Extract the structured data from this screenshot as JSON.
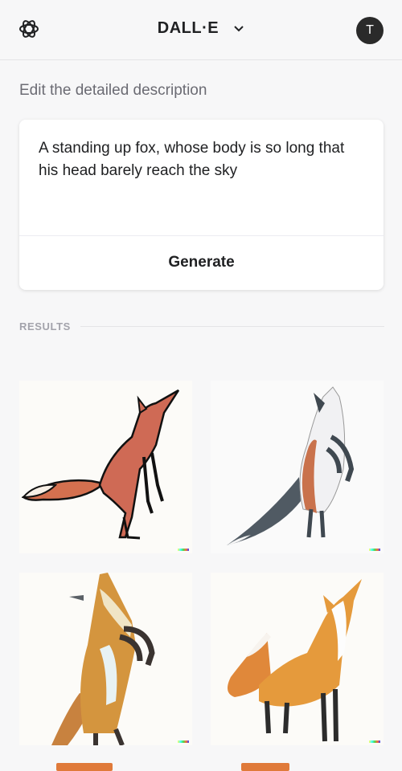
{
  "header": {
    "title": "DALL·E",
    "avatar_initial": "T",
    "logo_icon": "openai-logo-icon",
    "chevron_icon": "chevron-down-icon"
  },
  "editor": {
    "label": "Edit the detailed description",
    "prompt": "A standing up fox, whose body is so long that his head barely reach the sky",
    "generate_label": "Generate"
  },
  "results": {
    "label": "RESULTS",
    "images": [
      {
        "subject": "fox-image-1"
      },
      {
        "subject": "fox-image-2"
      },
      {
        "subject": "fox-image-3"
      },
      {
        "subject": "fox-image-4"
      }
    ]
  },
  "colors": {
    "background": "#f7f7f8",
    "fox_orange": "#e0883a",
    "fox_red": "#cf6a55",
    "text": "#202123"
  }
}
